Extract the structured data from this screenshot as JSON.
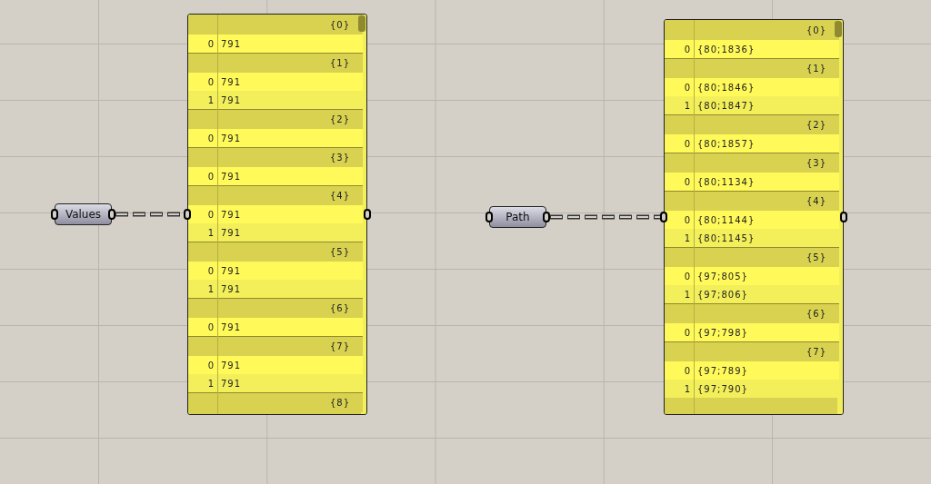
{
  "pairs": [
    {
      "node": {
        "label": "Values"
      },
      "panel": {
        "groups": [
          {
            "path": "{0}",
            "items": [
              {
                "index": "0",
                "value": "791"
              }
            ]
          },
          {
            "path": "{1}",
            "items": [
              {
                "index": "0",
                "value": "791"
              },
              {
                "index": "1",
                "value": "791"
              }
            ]
          },
          {
            "path": "{2}",
            "items": [
              {
                "index": "0",
                "value": "791"
              }
            ]
          },
          {
            "path": "{3}",
            "items": [
              {
                "index": "0",
                "value": "791"
              }
            ]
          },
          {
            "path": "{4}",
            "items": [
              {
                "index": "0",
                "value": "791"
              },
              {
                "index": "1",
                "value": "791"
              }
            ]
          },
          {
            "path": "{5}",
            "items": [
              {
                "index": "0",
                "value": "791"
              },
              {
                "index": "1",
                "value": "791"
              }
            ]
          },
          {
            "path": "{6}",
            "items": [
              {
                "index": "0",
                "value": "791"
              }
            ]
          },
          {
            "path": "{7}",
            "items": [
              {
                "index": "0",
                "value": "791"
              },
              {
                "index": "1",
                "value": "791"
              }
            ]
          },
          {
            "path": "{8}"
          }
        ]
      }
    },
    {
      "node": {
        "label": "Path"
      },
      "panel": {
        "groups": [
          {
            "path": "{0}",
            "items": [
              {
                "index": "0",
                "value": "{80;1836}"
              }
            ]
          },
          {
            "path": "{1}",
            "items": [
              {
                "index": "0",
                "value": "{80;1846}"
              },
              {
                "index": "1",
                "value": "{80;1847}"
              }
            ]
          },
          {
            "path": "{2}",
            "items": [
              {
                "index": "0",
                "value": "{80;1857}"
              }
            ]
          },
          {
            "path": "{3}",
            "items": [
              {
                "index": "0",
                "value": "{80;1134}"
              }
            ]
          },
          {
            "path": "{4}",
            "items": [
              {
                "index": "0",
                "value": "{80;1144}"
              },
              {
                "index": "1",
                "value": "{80;1145}"
              }
            ]
          },
          {
            "path": "{5}",
            "items": [
              {
                "index": "0",
                "value": "{97;805}"
              },
              {
                "index": "1",
                "value": "{97;806}"
              }
            ]
          },
          {
            "path": "{6}",
            "items": [
              {
                "index": "0",
                "value": "{97;798}"
              }
            ]
          },
          {
            "path": "{7}",
            "items": [
              {
                "index": "0",
                "value": "{97;789}"
              },
              {
                "index": "1",
                "value": "{97;790}"
              }
            ]
          }
        ]
      }
    }
  ]
}
